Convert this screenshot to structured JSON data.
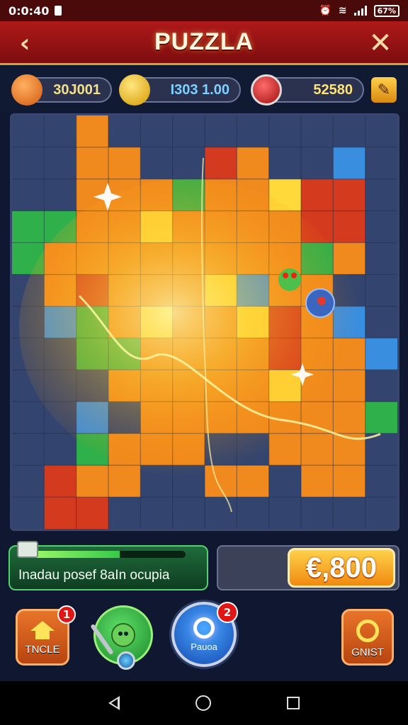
{
  "status_bar": {
    "time": "0:0:40",
    "battery": "67%"
  },
  "header": {
    "title": "PUZZLA"
  },
  "resources": [
    {
      "icon": "orange-fruit-icon",
      "value": "30J001"
    },
    {
      "icon": "gold-coin-face-icon",
      "value": "I303 1.00"
    },
    {
      "icon": "heart-ruby-icon",
      "value": "52580"
    }
  ],
  "board": {
    "columns": 12,
    "rows": 13,
    "colors": {
      "empty": "#33456e",
      "orange": "#f08a1e",
      "yellow": "#ffd83a",
      "green": "#2fb04a",
      "red": "#d43a1e",
      "blue": "#3a8ee0"
    }
  },
  "progress": {
    "text": "Inadau posef 8aIn ocupia",
    "fraction": 0.6
  },
  "score": {
    "value": "€,800"
  },
  "buttons": {
    "home": {
      "label": "TNCLE",
      "badge": "1"
    },
    "character": {},
    "power": {
      "label": "Pauoa",
      "badge": "2"
    },
    "quest": {
      "label": "GNIST"
    }
  }
}
